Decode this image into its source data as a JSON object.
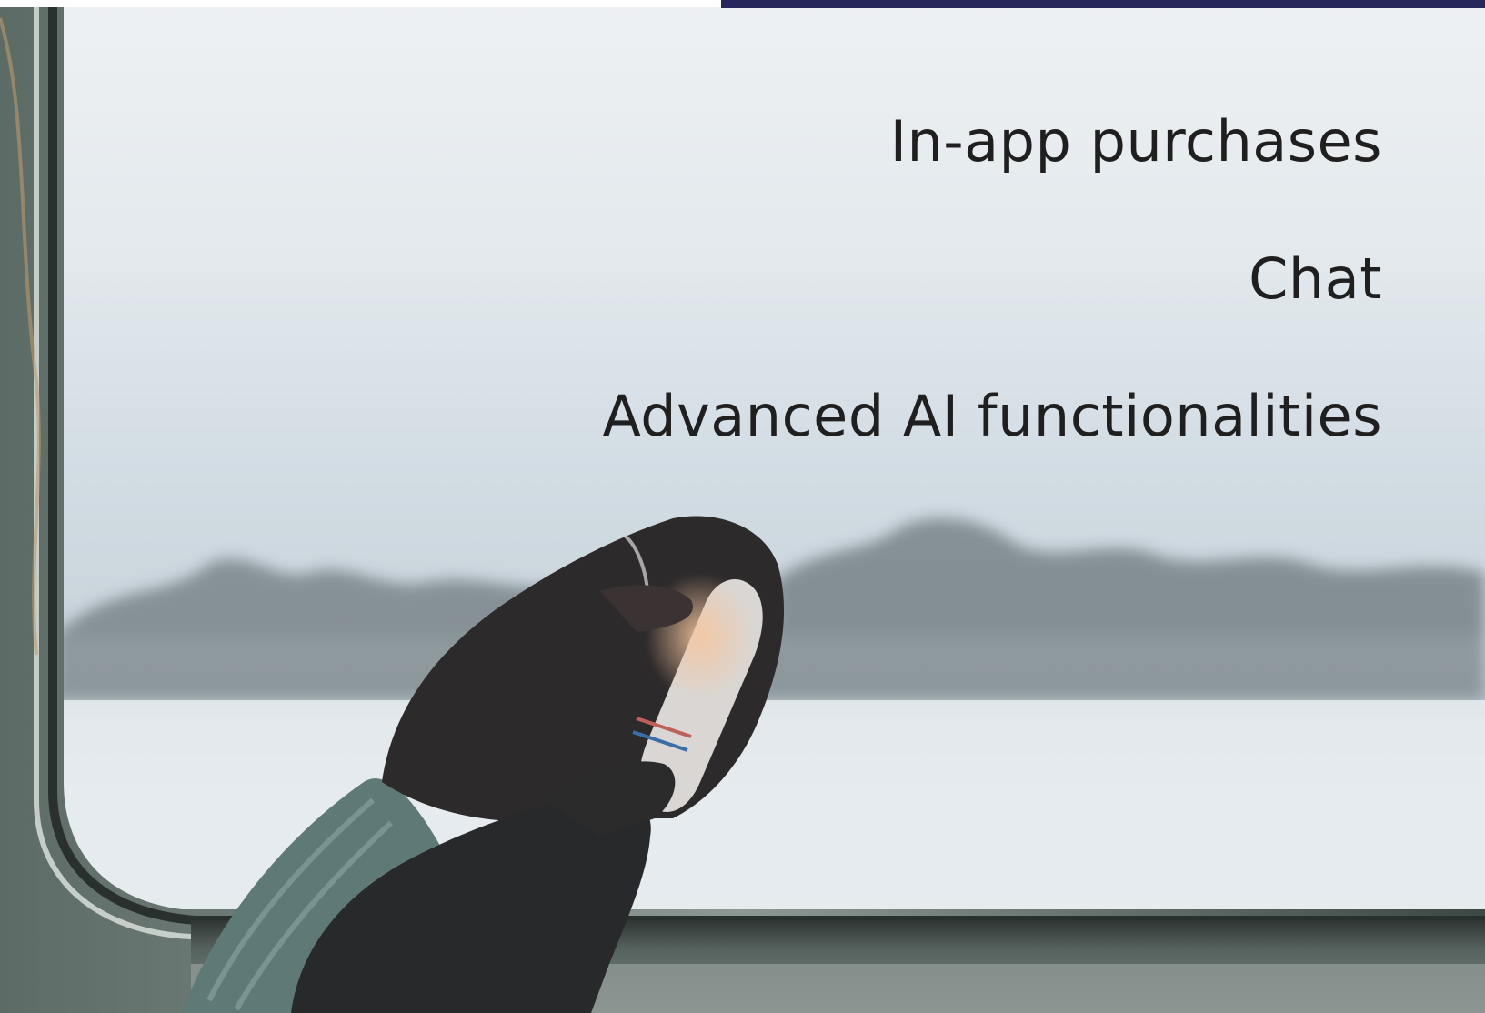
{
  "slide": {
    "accent_color": "#27275c",
    "features": [
      "In-app purchases",
      "Chat",
      "Advanced AI functionalities"
    ]
  },
  "background_photo": {
    "description_icon": "photo-hands-holding-phone-by-train-window"
  }
}
